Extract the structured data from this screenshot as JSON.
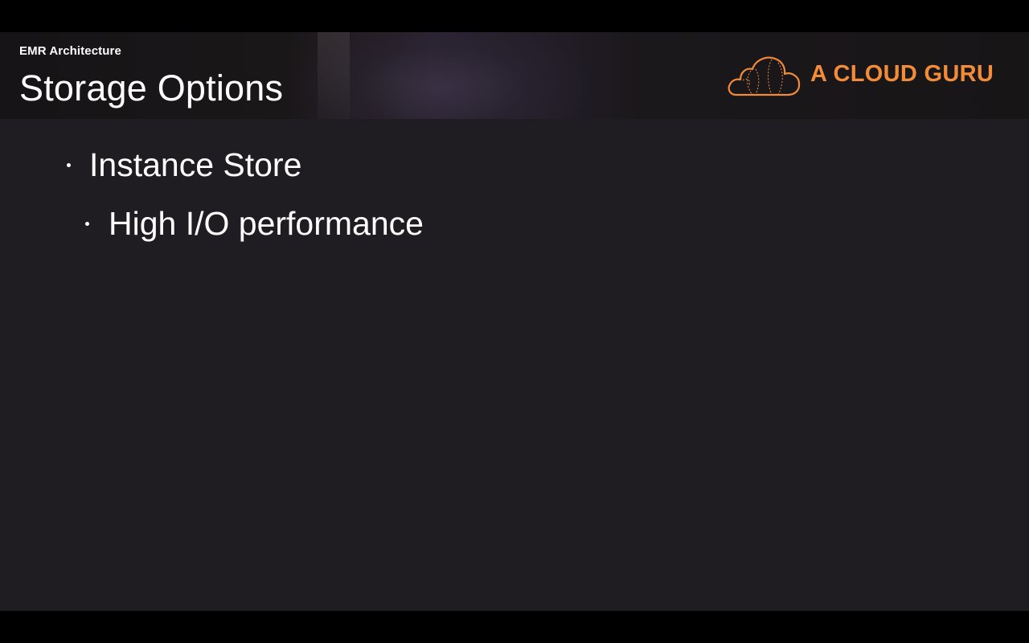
{
  "header": {
    "subtitle": "EMR Architecture",
    "title": "Storage Options"
  },
  "logo": {
    "text": "A CLOUD GURU",
    "icon": "cloud-icon",
    "color": "#f28c38"
  },
  "bullets": [
    {
      "level": 1,
      "text": "Instance Store"
    },
    {
      "level": 2,
      "text": "High I/O performance"
    }
  ],
  "colors": {
    "slide_background": "#1f1d21",
    "text": "#ffffff",
    "accent": "#f28c38"
  }
}
